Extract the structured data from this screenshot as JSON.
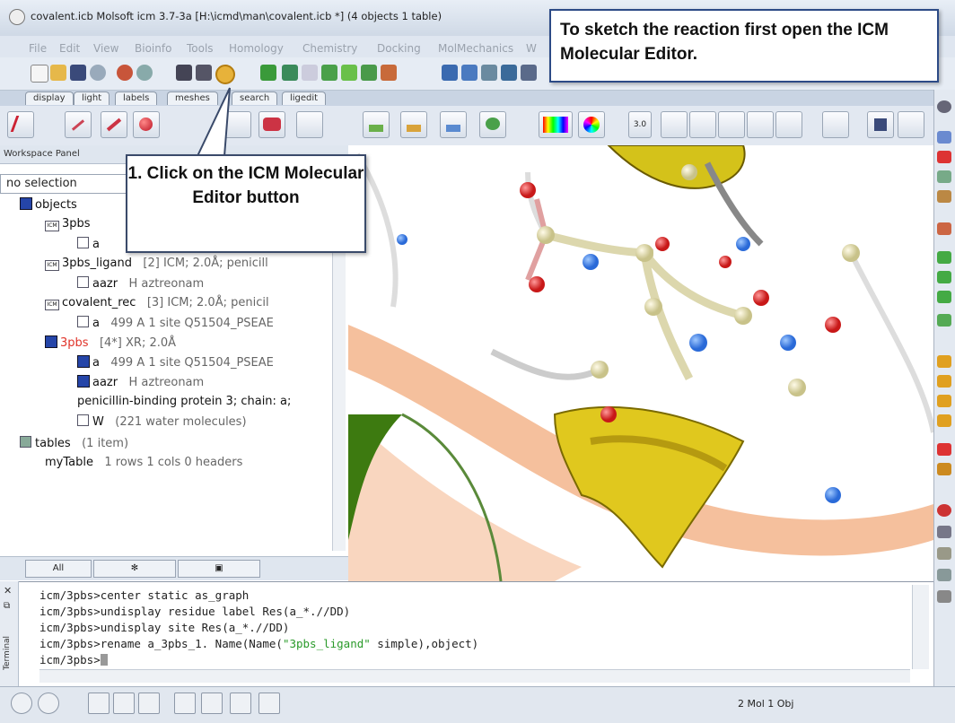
{
  "window": {
    "title": "covalent.icb Molsoft icm 3.7-3a  [H:\\icmd\\man\\covalent.icb *] (4 objects 1 table)"
  },
  "menu": [
    "File",
    "Edit",
    "View",
    "Bioinfo",
    "Tools",
    "Homology",
    "Chemistry",
    "Docking",
    "MolMechanics",
    "W"
  ],
  "tabs": [
    "display",
    "light",
    "labels",
    "meshes",
    "search",
    "ligedit"
  ],
  "toolbar": {
    "size_value": "3.0"
  },
  "workspace": {
    "title": "Workspace Panel",
    "selection": "no selection",
    "tree": [
      {
        "name": "objects",
        "meta": ""
      },
      {
        "name": "3pbs",
        "meta": ""
      },
      {
        "name": "a",
        "meta": ""
      },
      {
        "name": "3pbs_ligand",
        "meta": "[2] ICM; 2.0Å; penicill"
      },
      {
        "name": "aazr",
        "meta": "H  aztreonam"
      },
      {
        "name": "covalent_rec",
        "meta": "[3] ICM; 2.0Å; penicil"
      },
      {
        "name": "a",
        "meta": "499 A  1 site Q51504_PSEAE"
      },
      {
        "name": "3pbs",
        "meta": "[4*] XR; 2.0Å"
      },
      {
        "name": "a",
        "meta": "499 A  1 site Q51504_PSEAE"
      },
      {
        "name": "aazr",
        "meta": "H  aztreonam"
      },
      {
        "name": "penicillin-binding protein 3; chain: a;",
        "meta": ""
      },
      {
        "name": "W",
        "meta": "(221 water molecules)"
      },
      {
        "name": "tables",
        "meta": "(1 item)"
      },
      {
        "name": "myTable",
        "meta": "1 rows 1 cols 0 headers"
      }
    ],
    "bottom_tabs": [
      "All",
      "",
      ""
    ]
  },
  "terminal": {
    "label": "Terminal",
    "lines": [
      "icm/3pbs>center static as_graph",
      "icm/3pbs>undisplay residue label Res(a_*.//DD)",
      "icm/3pbs>undisplay site Res(a_*.//DD)",
      "icm/3pbs>rename a_3pbs_1. Name(Name(",
      "icm/3pbs>"
    ],
    "line4_string": "\"3pbs_ligand\"",
    "line4_rest": " simple),object)"
  },
  "status": {
    "text": "2 Mol 1 Obj"
  },
  "callouts": {
    "top": "To sketch the reaction first open the ICM Molecular Editor.",
    "step": "1. Click on the ICM Molecular Editor button"
  },
  "colors": {
    "callout_border": "#2c4a86",
    "accent_red": "#e0342a",
    "string_green": "#2a9a2a"
  }
}
